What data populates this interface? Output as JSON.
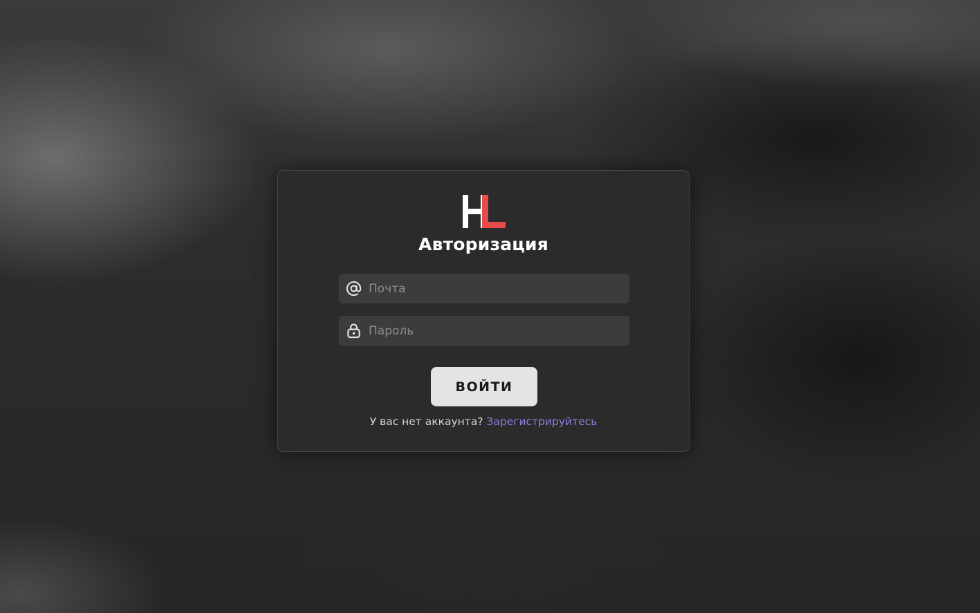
{
  "logo": {
    "text": "HL",
    "colors": {
      "h": "#ffffff",
      "l": "#e84b4b"
    }
  },
  "title": "Авторизация",
  "email_field": {
    "placeholder": "Почта",
    "value": "",
    "icon": "at-sign-icon"
  },
  "password_field": {
    "placeholder": "Пароль",
    "value": "",
    "icon": "lock-icon"
  },
  "login_button": {
    "label": "ВОЙТИ"
  },
  "footer": {
    "prompt": "У вас нет аккаунта?",
    "register_link": "Зарегистрируйтесь"
  },
  "colors": {
    "card_background": "#2b2b2b",
    "input_background": "#3c3c3c",
    "button_background": "#e4e4e4",
    "link": "#8a7fe0",
    "accent_red": "#e84b4b"
  }
}
